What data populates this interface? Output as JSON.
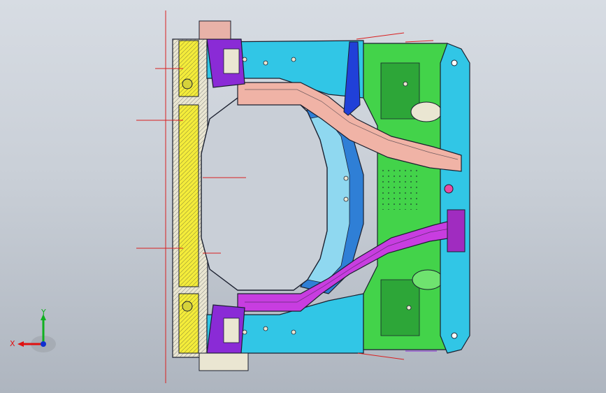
{
  "viewport": {
    "background_top": "#d7dce3",
    "background_bottom": "#aeb5bf"
  },
  "model": {
    "colors": {
      "edge": "#1a1f2e",
      "cyan": "#31c6e6",
      "blue": "#2f7fd6",
      "light_blue": "#8fd8f0",
      "green": "#43d34a",
      "dark_green": "#2da638",
      "magenta": "#c83de0",
      "purple": "#8a2bd6",
      "salmon": "#f0b3a6",
      "yellow": "#f4ec3a",
      "cream": "#eae6d2",
      "leader": "#d92020"
    }
  },
  "triad": {
    "x_label": "X",
    "y_label": "Y",
    "x_color": "#e01010",
    "y_color": "#10b020",
    "z_color": "#1030d0"
  }
}
